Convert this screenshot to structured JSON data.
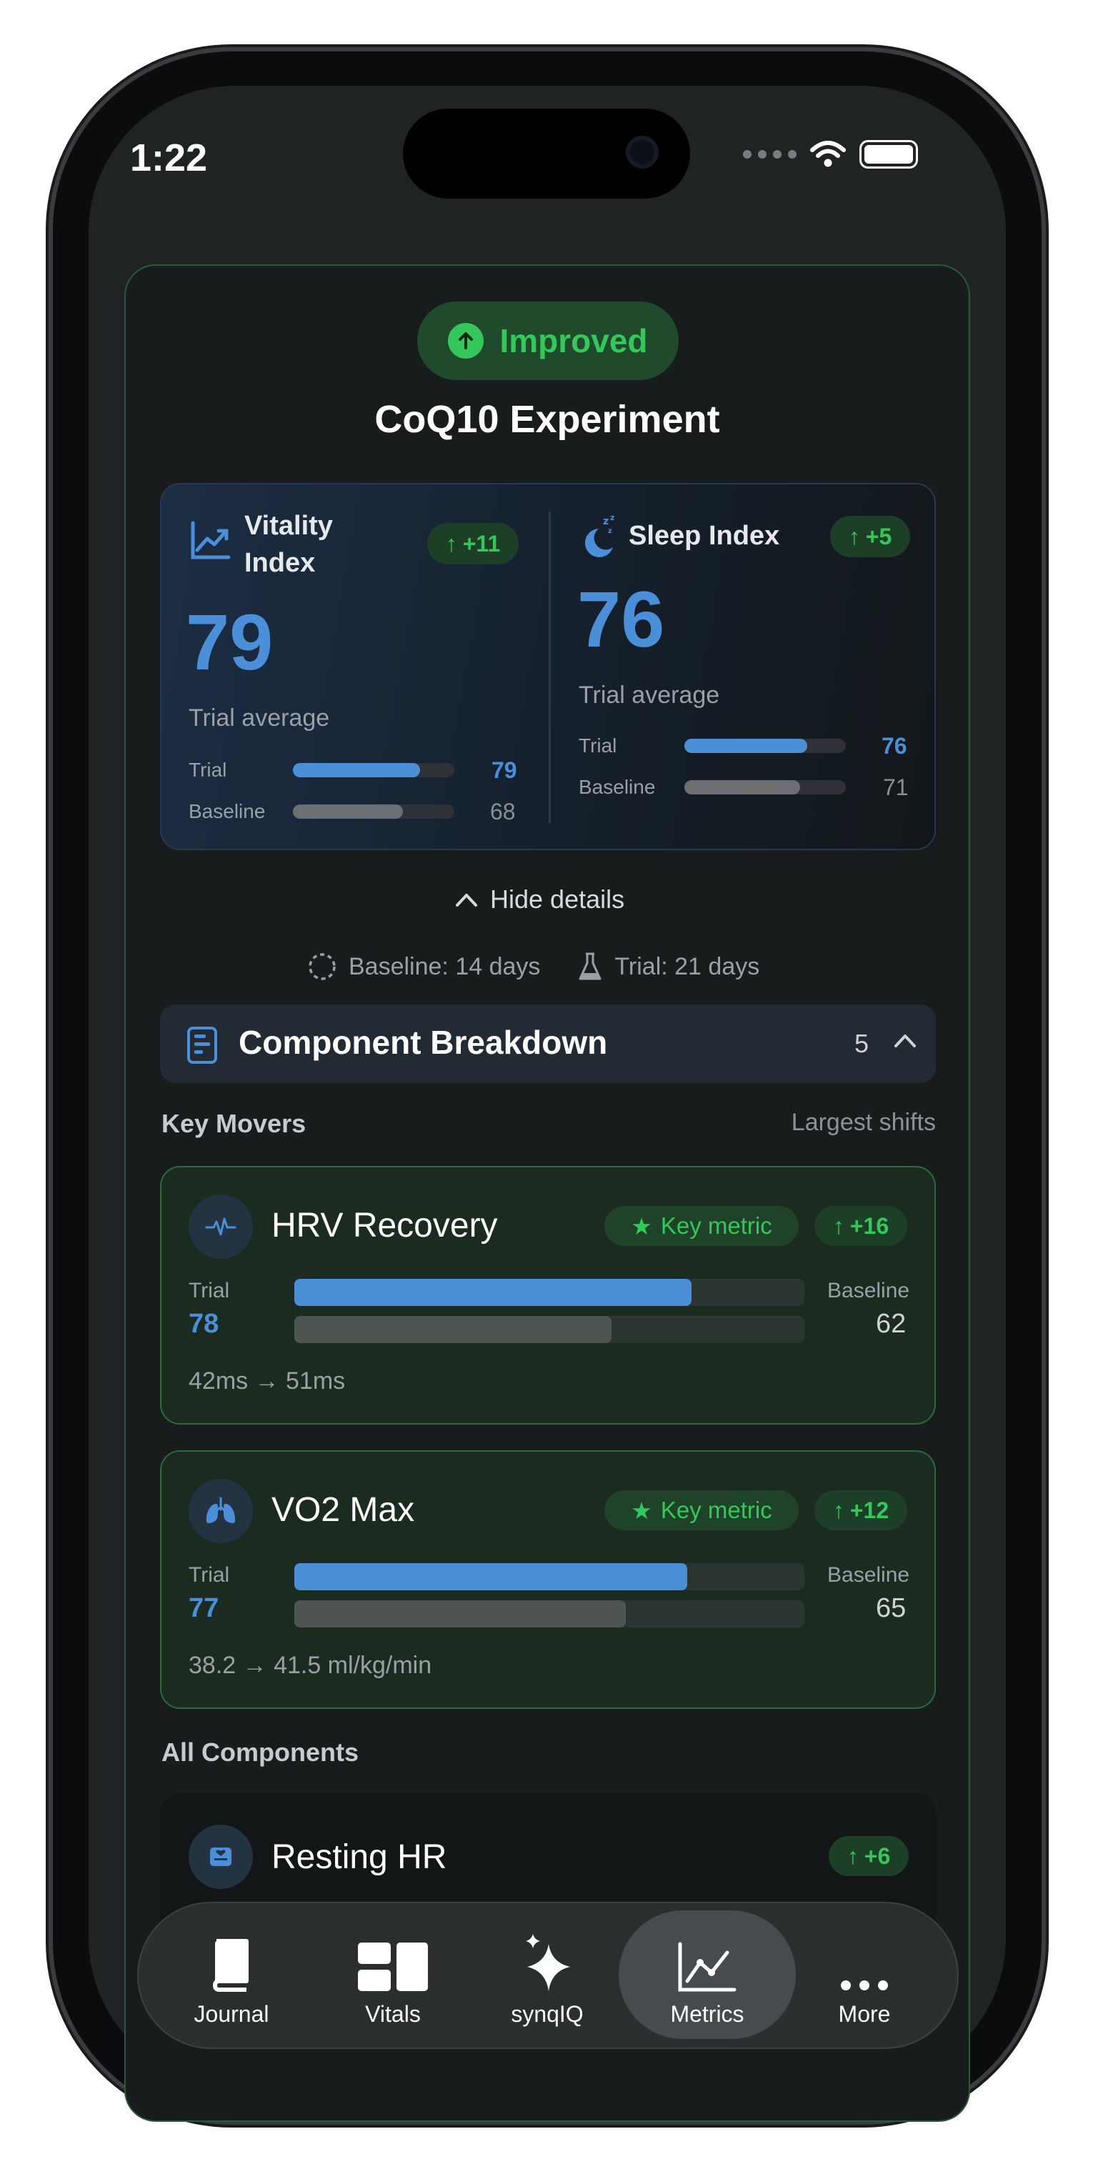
{
  "status": {
    "time": "1:22"
  },
  "experiment": {
    "status_label": "Improved",
    "title": "CoQ10 Experiment",
    "colors": {
      "accent_green": "#34c759",
      "accent_blue": "#4a8fd8"
    }
  },
  "indices": [
    {
      "name": "Vitality Index",
      "icon": "trend-chart-icon",
      "delta": "+11",
      "value": "79",
      "caption": "Trial average",
      "trial_label": "Trial",
      "trial_value": "79",
      "trial_fraction": 0.79,
      "baseline_label": "Baseline",
      "baseline_value": "68",
      "baseline_fraction": 0.68
    },
    {
      "name": "Sleep Index",
      "icon": "moon-zzz-icon",
      "delta": "+5",
      "value": "76",
      "caption": "Trial average",
      "trial_label": "Trial",
      "trial_value": "76",
      "trial_fraction": 0.76,
      "baseline_label": "Baseline",
      "baseline_value": "71",
      "baseline_fraction": 0.71
    }
  ],
  "details_toggle": "Hide details",
  "meta": {
    "baseline": "Baseline: 14 days",
    "trial": "Trial: 21 days"
  },
  "breakdown": {
    "title": "Component Breakdown",
    "count": "5"
  },
  "key_movers": {
    "heading": "Key Movers",
    "subheading": "Largest shifts"
  },
  "movers": [
    {
      "name": "HRV Recovery",
      "icon": "heartbeat-icon",
      "key_label": "Key metric",
      "delta": "+16",
      "trial_label": "Trial",
      "trial_value": "78",
      "trial_fraction": 0.78,
      "baseline_label": "Baseline",
      "baseline_value": "62",
      "baseline_fraction": 0.62,
      "range": "42ms → 51ms"
    },
    {
      "name": "VO2 Max",
      "icon": "lungs-icon",
      "key_label": "Key metric",
      "delta": "+12",
      "trial_label": "Trial",
      "trial_value": "77",
      "trial_fraction": 0.77,
      "baseline_label": "Baseline",
      "baseline_value": "65",
      "baseline_fraction": 0.65,
      "range": "38.2 → 41.5 ml/kg/min"
    }
  ],
  "all_components": {
    "heading": "All Components"
  },
  "resting": {
    "name": "Resting HR",
    "delta": "+6"
  },
  "tabs": [
    {
      "label": "Journal",
      "icon": "book-icon"
    },
    {
      "label": "Vitals",
      "icon": "grid-icon"
    },
    {
      "label": "synqIQ",
      "icon": "sparkles-icon"
    },
    {
      "label": "Metrics",
      "icon": "chart-icon",
      "active": true
    },
    {
      "label": "More",
      "icon": "ellipsis-icon"
    }
  ]
}
